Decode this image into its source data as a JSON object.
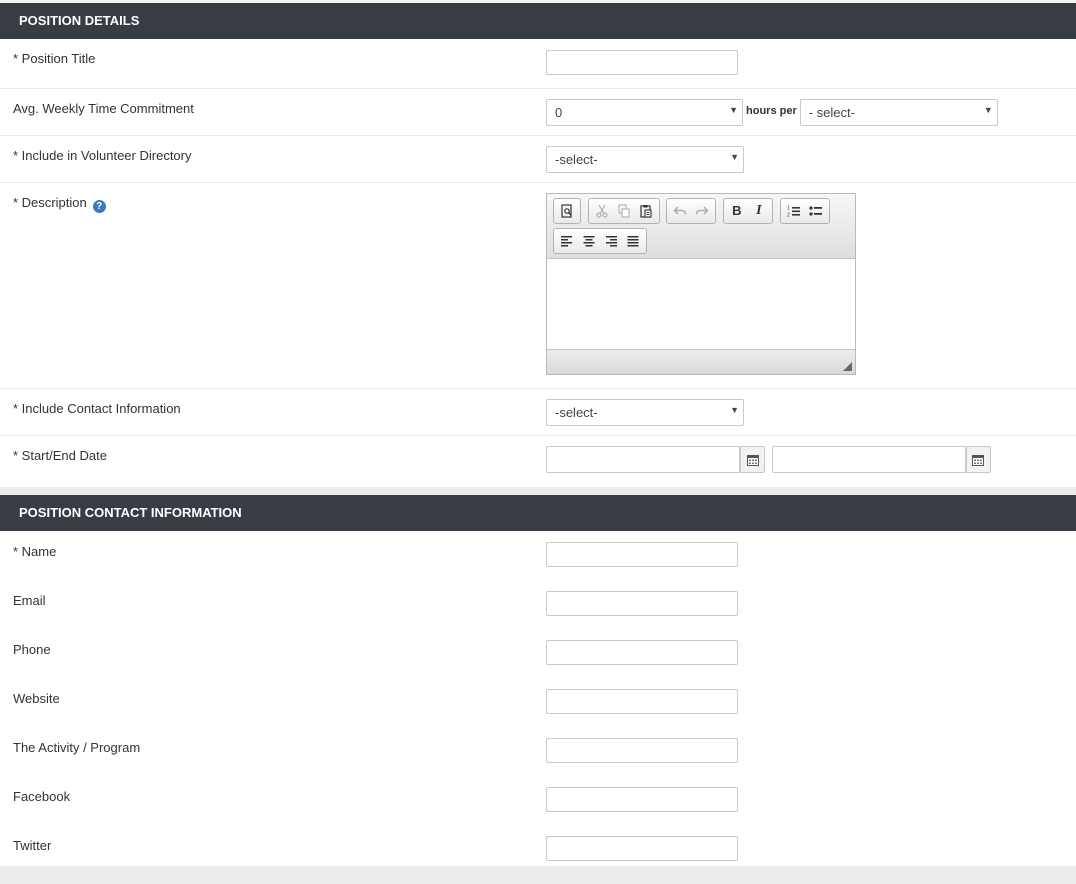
{
  "position_details": {
    "header": "POSITION DETAILS",
    "title_label": "* Position Title",
    "title_value": "",
    "commitment_label": "Avg. Weekly Time Commitment",
    "commitment_value": "0",
    "hours_per_label": "hours per",
    "period_value": "- select-",
    "directory_label": "* Include in Volunteer Directory",
    "directory_value": "-select-",
    "description_label": "* Description",
    "help_icon_text": "?",
    "contact_label": "* Include Contact Information",
    "contact_value": "-select-",
    "dates_label": "* Start/End Date",
    "start_value": "",
    "end_value": ""
  },
  "editor_toolbar": {
    "bold": "B",
    "italic": "I"
  },
  "contact_info": {
    "header": "POSITION CONTACT INFORMATION",
    "fields": [
      {
        "label": "* Name",
        "value": ""
      },
      {
        "label": "Email",
        "value": ""
      },
      {
        "label": "Phone",
        "value": ""
      },
      {
        "label": "Website",
        "value": ""
      },
      {
        "label": "The Activity / Program",
        "value": ""
      },
      {
        "label": "Facebook",
        "value": ""
      },
      {
        "label": "Twitter",
        "value": ""
      }
    ]
  },
  "icons": {
    "dropdown": "chevron-down-icon",
    "calendar": "calendar-icon",
    "help": "help-icon"
  }
}
